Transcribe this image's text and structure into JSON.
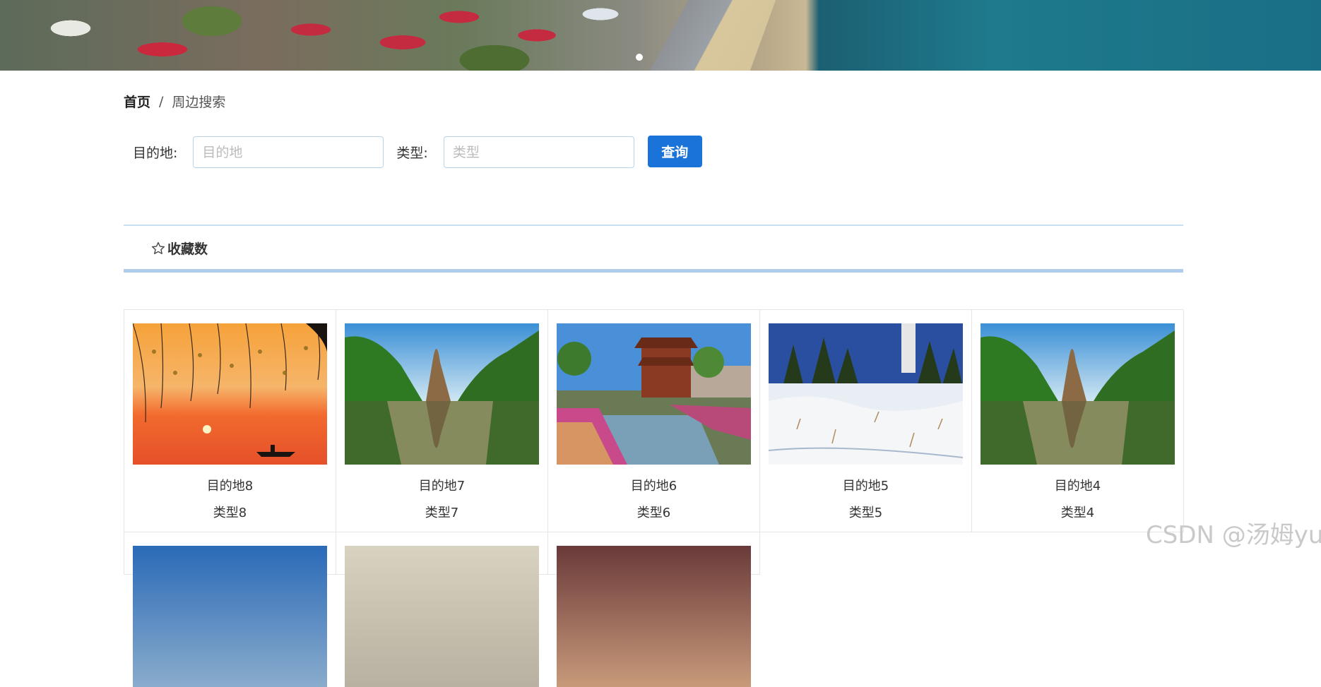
{
  "breadcrumb": {
    "home": "首页",
    "separator": "/",
    "current": "周边搜索"
  },
  "search": {
    "destination_label": "目的地:",
    "destination_placeholder": "目的地",
    "type_label": "类型:",
    "type_placeholder": "类型",
    "button_label": "查询"
  },
  "sortbar": {
    "label": "收藏数",
    "icon": "star-outline-icon"
  },
  "cards": [
    {
      "name": "目的地8",
      "type": "类型8",
      "image": "sunset-lake-boat"
    },
    {
      "name": "目的地7",
      "type": "类型7",
      "image": "green-mountain-river"
    },
    {
      "name": "目的地6",
      "type": "类型6",
      "image": "chinese-pavilion-garden"
    },
    {
      "name": "目的地5",
      "type": "类型5",
      "image": "snowy-forest-lighthouse"
    },
    {
      "name": "目的地4",
      "type": "类型4",
      "image": "green-mountain-river"
    }
  ],
  "more_cards": [
    {
      "image": "snowy-mountains"
    },
    {
      "image": "misty-landscape"
    },
    {
      "image": "sunset-clouds"
    }
  ],
  "watermark": "CSDN @汤姆yu",
  "colors": {
    "accent": "#1a73d8",
    "border": "#b0cdec"
  }
}
